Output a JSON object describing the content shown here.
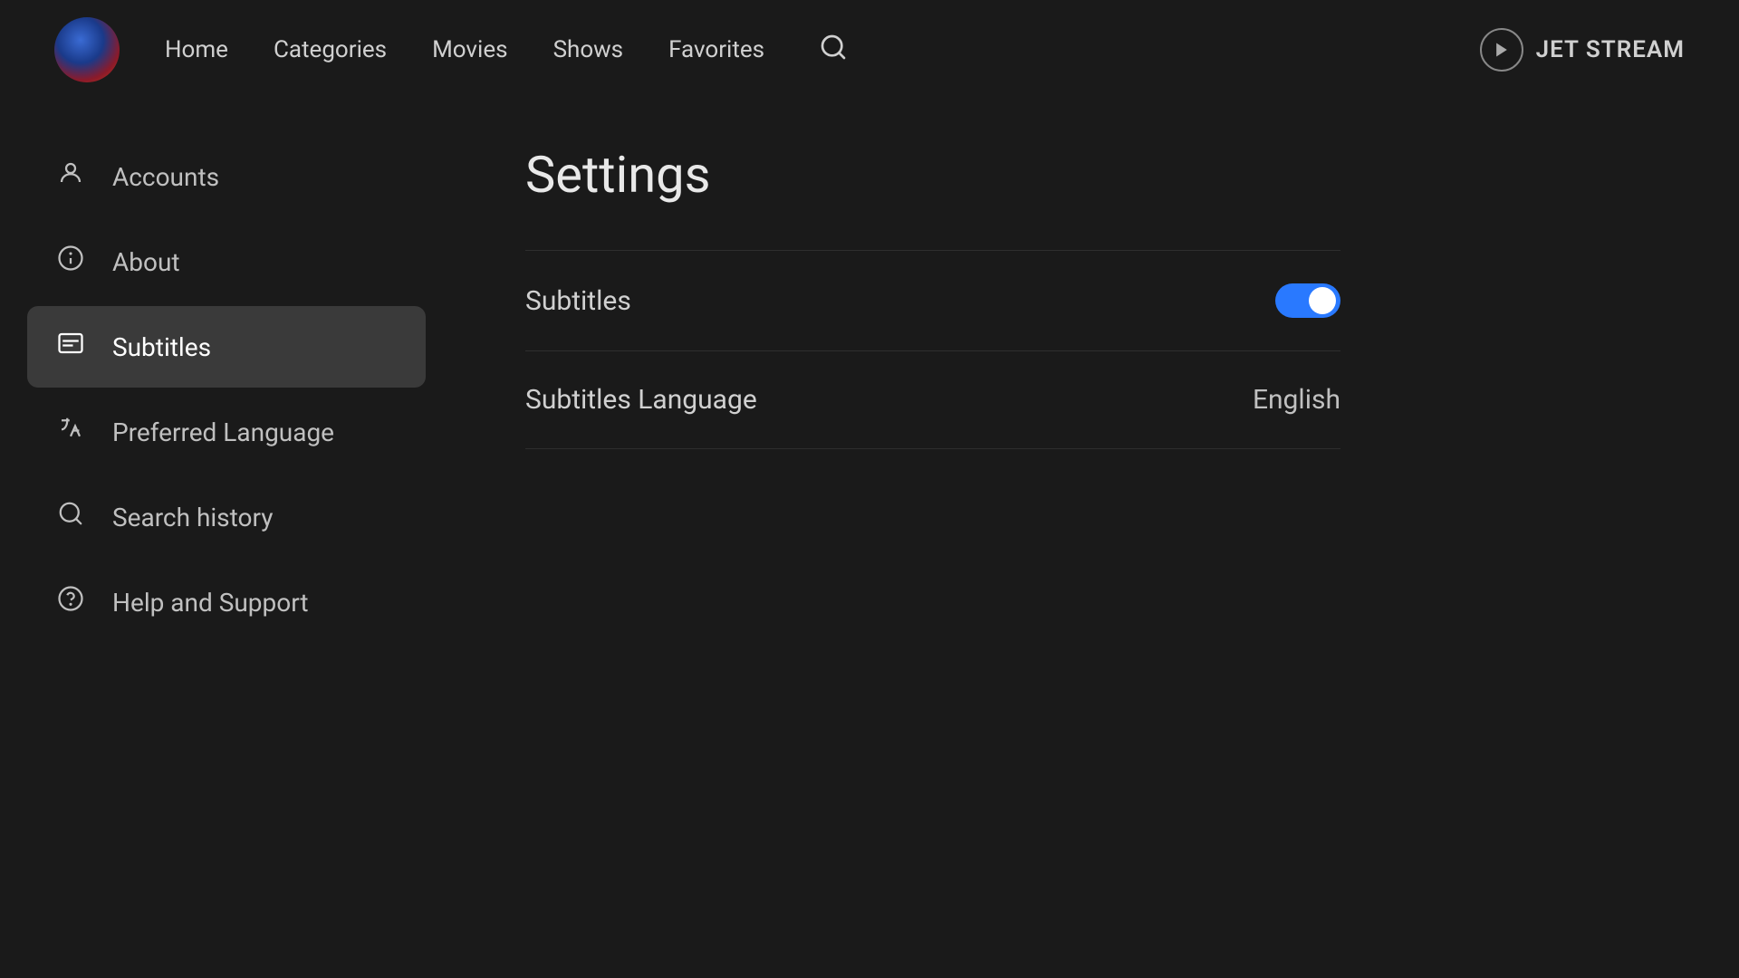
{
  "header": {
    "nav": {
      "home": "Home",
      "categories": "Categories",
      "movies": "Movies",
      "shows": "Shows",
      "favorites": "Favorites"
    },
    "brand": {
      "name": "JET STREAM"
    }
  },
  "sidebar": {
    "items": [
      {
        "id": "accounts",
        "label": "Accounts",
        "icon": "person"
      },
      {
        "id": "about",
        "label": "About",
        "icon": "info"
      },
      {
        "id": "subtitles",
        "label": "Subtitles",
        "icon": "subtitles",
        "active": true
      },
      {
        "id": "preferred-language",
        "label": "Preferred Language",
        "icon": "translate"
      },
      {
        "id": "search-history",
        "label": "Search history",
        "icon": "search"
      },
      {
        "id": "help-support",
        "label": "Help and Support",
        "icon": "help"
      }
    ]
  },
  "content": {
    "title": "Settings",
    "rows": [
      {
        "id": "subtitles-toggle",
        "label": "Subtitles",
        "type": "toggle",
        "value": true
      },
      {
        "id": "subtitles-language",
        "label": "Subtitles Language",
        "type": "value",
        "value": "English"
      }
    ]
  },
  "colors": {
    "active_toggle": "#2979ff",
    "active_sidebar_bg": "#3a3a3a",
    "background": "#1a1a1a"
  }
}
